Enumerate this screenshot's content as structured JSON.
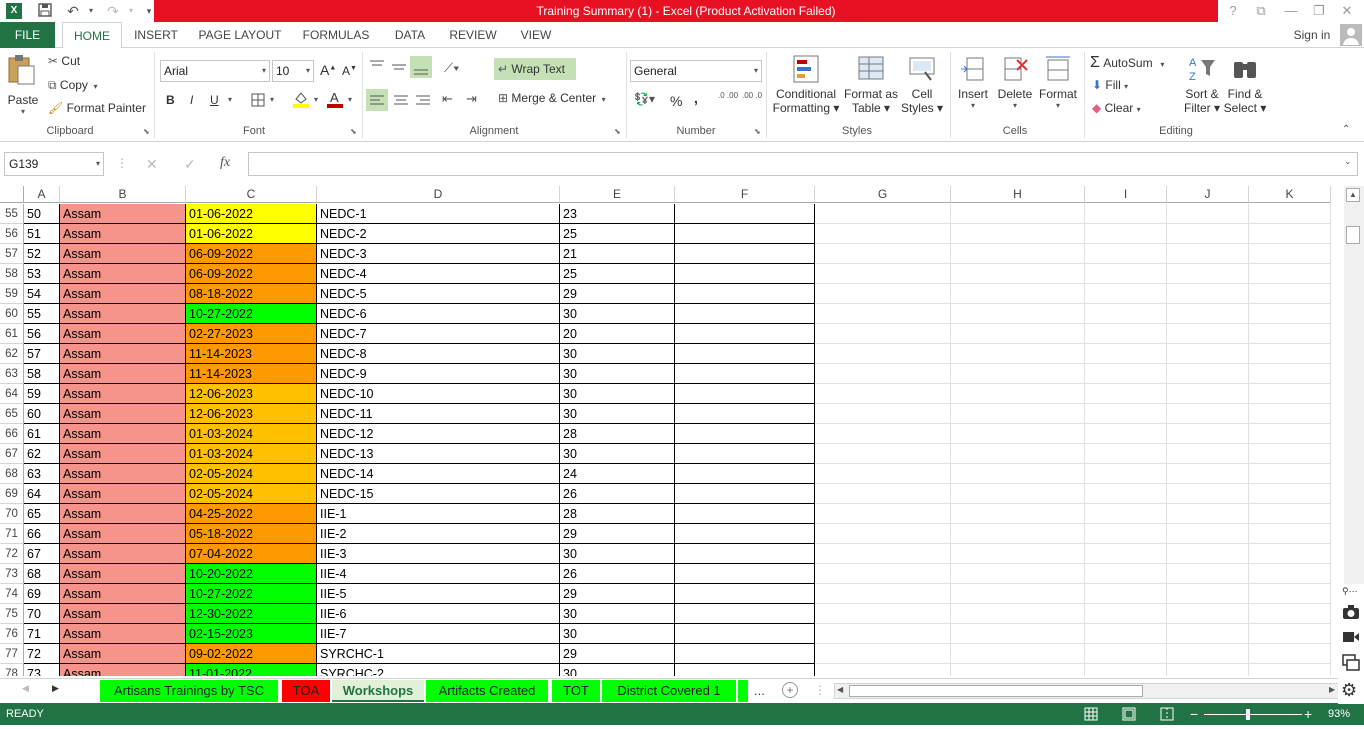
{
  "window": {
    "title": "Training Summary (1) -  Excel (Product Activation Failed)",
    "help": "?",
    "ribbon_display": "⧉",
    "minimize": "—",
    "maximize": "❐",
    "close": "✕"
  },
  "quick_access": {
    "save": "💾",
    "undo": "↶",
    "redo": "↷",
    "customize": "▾"
  },
  "tabs": [
    "FILE",
    "HOME",
    "INSERT",
    "PAGE LAYOUT",
    "FORMULAS",
    "DATA",
    "REVIEW",
    "VIEW"
  ],
  "sign_in": "Sign in",
  "ribbon": {
    "clipboard": {
      "paste": "Paste",
      "cut": "Cut",
      "copy": "Copy",
      "format_painter": "Format Painter",
      "label": "Clipboard"
    },
    "font": {
      "name": "Arial",
      "size": "10",
      "grow": "A",
      "shrink": "A",
      "bold": "B",
      "italic": "I",
      "underline": "U",
      "label": "Font"
    },
    "alignment": {
      "wrap_text": "Wrap Text",
      "merge_center": "Merge & Center",
      "label": "Alignment"
    },
    "number": {
      "format": "General",
      "percent": "%",
      "comma": ",",
      "inc_dec": ".0 .00",
      "dec_dec": ".00 .0",
      "label": "Number"
    },
    "styles": {
      "conditional": [
        "Conditional",
        "Formatting"
      ],
      "format_table": [
        "Format as",
        "Table"
      ],
      "cell_styles": [
        "Cell",
        "Styles"
      ],
      "label": "Styles"
    },
    "cells": {
      "insert": "Insert",
      "delete": "Delete",
      "format": "Format",
      "label": "Cells"
    },
    "editing": {
      "autosum": "AutoSum",
      "fill": "Fill",
      "clear": "Clear",
      "sort_filter": [
        "Sort &",
        "Filter"
      ],
      "find_select": [
        "Find &",
        "Select"
      ],
      "label": "Editing"
    }
  },
  "formula_bar": {
    "name_box": "G139",
    "fx": "fx",
    "cancel": "✕",
    "enter": "✓",
    "value": ""
  },
  "columns": [
    "A",
    "B",
    "C",
    "D",
    "E",
    "F",
    "G",
    "H",
    "I",
    "J",
    "K"
  ],
  "rows": [
    {
      "row": "55",
      "a": "50",
      "b": "Assam",
      "c": "01-06-2022",
      "d": "NEDC-1",
      "e": "23",
      "c_color": "#ffff00"
    },
    {
      "row": "56",
      "a": "51",
      "b": "Assam",
      "c": "01-06-2022",
      "d": "NEDC-2",
      "e": "25",
      "c_color": "#ffff00"
    },
    {
      "row": "57",
      "a": "52",
      "b": "Assam",
      "c": "06-09-2022",
      "d": "NEDC-3",
      "e": "21",
      "c_color": "#ff9900"
    },
    {
      "row": "58",
      "a": "53",
      "b": "Assam",
      "c": "06-09-2022",
      "d": "NEDC-4",
      "e": "25",
      "c_color": "#ff9900"
    },
    {
      "row": "59",
      "a": "54",
      "b": "Assam",
      "c": "08-18-2022",
      "d": "NEDC-5",
      "e": "29",
      "c_color": "#ff9900"
    },
    {
      "row": "60",
      "a": "55",
      "b": "Assam",
      "c": "10-27-2022",
      "d": "NEDC-6",
      "e": "30",
      "c_color": "#00ff00"
    },
    {
      "row": "61",
      "a": "56",
      "b": "Assam",
      "c": "02-27-2023",
      "d": "NEDC-7",
      "e": "20",
      "c_color": "#ff9900"
    },
    {
      "row": "62",
      "a": "57",
      "b": "Assam",
      "c": "11-14-2023",
      "d": "NEDC-8",
      "e": "30",
      "c_color": "#ff9900"
    },
    {
      "row": "63",
      "a": "58",
      "b": "Assam",
      "c": "11-14-2023",
      "d": "NEDC-9",
      "e": "30",
      "c_color": "#ff9900"
    },
    {
      "row": "64",
      "a": "59",
      "b": "Assam",
      "c": "12-06-2023",
      "d": "NEDC-10",
      "e": "30",
      "c_color": "#ffc000"
    },
    {
      "row": "65",
      "a": "60",
      "b": "Assam",
      "c": "12-06-2023",
      "d": "NEDC-11",
      "e": "30",
      "c_color": "#ffc000"
    },
    {
      "row": "66",
      "a": "61",
      "b": "Assam",
      "c": "01-03-2024",
      "d": "NEDC-12",
      "e": "28",
      "c_color": "#ffc000"
    },
    {
      "row": "67",
      "a": "62",
      "b": "Assam",
      "c": "01-03-2024",
      "d": "NEDC-13",
      "e": "30",
      "c_color": "#ffc000"
    },
    {
      "row": "68",
      "a": "63",
      "b": "Assam",
      "c": "02-05-2024",
      "d": "NEDC-14",
      "e": "24",
      "c_color": "#ffc000"
    },
    {
      "row": "69",
      "a": "64",
      "b": "Assam",
      "c": "02-05-2024",
      "d": "NEDC-15",
      "e": "26",
      "c_color": "#ffc000"
    },
    {
      "row": "70",
      "a": "65",
      "b": "Assam",
      "c": "04-25-2022",
      "d": "IIE-1",
      "e": "28",
      "c_color": "#ff9900"
    },
    {
      "row": "71",
      "a": "66",
      "b": "Assam",
      "c": "05-18-2022",
      "d": "IIE-2",
      "e": "29",
      "c_color": "#ff9900"
    },
    {
      "row": "72",
      "a": "67",
      "b": "Assam",
      "c": "07-04-2022",
      "d": "IIE-3",
      "e": "30",
      "c_color": "#ff9900"
    },
    {
      "row": "73",
      "a": "68",
      "b": "Assam",
      "c": "10-20-2022",
      "d": "IIE-4",
      "e": "26",
      "c_color": "#00ff00"
    },
    {
      "row": "74",
      "a": "69",
      "b": "Assam",
      "c": "10-27-2022",
      "d": "IIE-5",
      "e": "29",
      "c_color": "#00ff00"
    },
    {
      "row": "75",
      "a": "70",
      "b": "Assam",
      "c": "12-30-2022",
      "d": "IIE-6",
      "e": "30",
      "c_color": "#00ff00"
    },
    {
      "row": "76",
      "a": "71",
      "b": "Assam",
      "c": "02-15-2023",
      "d": "IIE-7",
      "e": "30",
      "c_color": "#00ff00"
    },
    {
      "row": "77",
      "a": "72",
      "b": "Assam",
      "c": "09-02-2022",
      "d": "SYRCHC-1",
      "e": "29",
      "c_color": "#ff9900"
    },
    {
      "row": "78",
      "a": "73",
      "b": "Assam",
      "c": "11-01-2022",
      "d": "SYRCHC-2",
      "e": "30",
      "c_color": "#00ff00"
    }
  ],
  "colors": {
    "assam_fill": "#f4948a",
    "excel_green": "#217346",
    "title_red": "#e81123"
  },
  "sheet_tabs": [
    {
      "label": "Artisans Trainings by TSC",
      "color": "#00ff00",
      "active": false
    },
    {
      "label": "TOA",
      "color": "#ff0000",
      "active": false
    },
    {
      "label": "Workshops",
      "color": "#e2f0d9",
      "active": true
    },
    {
      "label": "Artifacts Created",
      "color": "#00ff00",
      "active": false
    },
    {
      "label": "TOT",
      "color": "#00ff00",
      "active": false
    },
    {
      "label": "District Covered 1",
      "color": "#00ff00",
      "active": false
    }
  ],
  "sheet_more": "...",
  "status": {
    "ready": "READY",
    "zoom": "93%"
  }
}
